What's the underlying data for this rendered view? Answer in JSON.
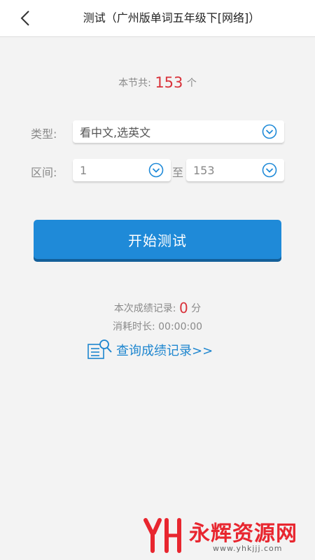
{
  "header": {
    "back_icon": "back-arrow-icon",
    "title": "测试（广州版单词五年级下[网络]）"
  },
  "summary": {
    "count_prefix": "本节共:",
    "count_value": "153",
    "count_suffix": "个"
  },
  "form": {
    "type_label": "类型:",
    "type_value": "看中文,选英文",
    "range_label": "区间:",
    "range_start": "1",
    "range_sep": "至",
    "range_end": "153",
    "dropdown_icon": "chevron-down-circle-icon"
  },
  "actions": {
    "start_label": "开始测试"
  },
  "result": {
    "score_prefix": "本次成绩记录:",
    "score_value": "0",
    "score_suffix": "分",
    "time_label": "消耗时长:",
    "time_value": "00:00:00"
  },
  "history": {
    "icon": "document-search-icon",
    "link_label": "查询成绩记录>>"
  },
  "watermark": {
    "name": "永辉资源网",
    "url": "www.yhkjjj.com"
  },
  "colors": {
    "accent_blue": "#1f8ad8",
    "link_blue": "#1e86cf",
    "highlight_red": "#d9323a",
    "background": "#f3f3f3"
  }
}
